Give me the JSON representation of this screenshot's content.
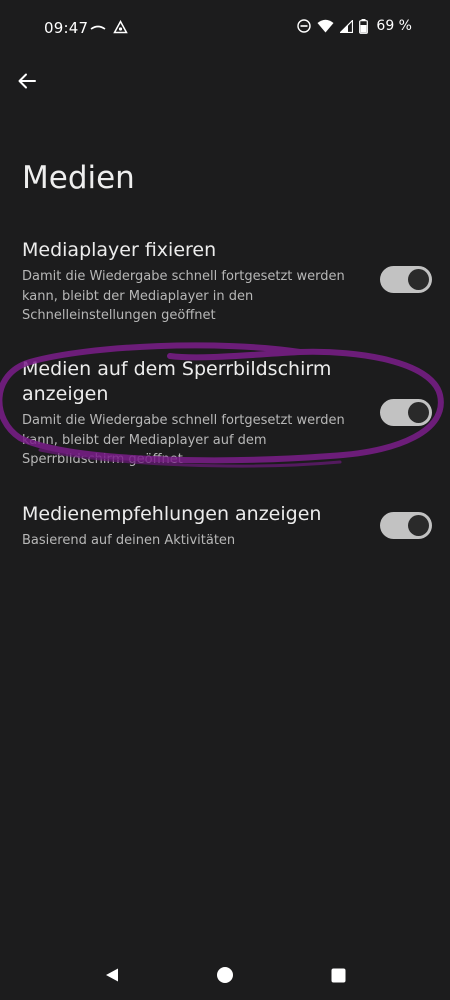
{
  "status_bar": {
    "time": "09:47",
    "battery_percent": "69 %",
    "icons_left": [
      "wave-icon",
      "navigation-app-icon"
    ],
    "icons_right": [
      "do-not-disturb-icon",
      "wifi-icon",
      "cell-signal-icon",
      "battery-icon"
    ]
  },
  "header": {
    "back_icon": "arrow-back-icon",
    "title": "Medien"
  },
  "settings": [
    {
      "title": "Mediaplayer fixieren",
      "description": "Damit die Wiedergabe schnell fortgesetzt werden kann, bleibt der Mediaplayer in den Schnelleinstellungen geöffnet",
      "enabled": true
    },
    {
      "title": "Medien auf dem Sperrbildschirm anzeigen",
      "description": "Damit die Wiedergabe schnell fortgesetzt werden kann, bleibt der Mediaplayer auf dem Sperrbildschirm geöffnet",
      "enabled": true
    },
    {
      "title": "Medienempfehlungen anzeigen",
      "description": "Basierend auf deinen Aktivitäten",
      "enabled": true
    }
  ],
  "colors": {
    "background": "#1c1c1d",
    "toggle_track": "#c2c2c2",
    "toggle_knob": "#2a2a2a",
    "annotation_stroke": "#7a1d8a"
  },
  "nav_bar": {
    "icons": [
      "back-triangle-icon",
      "home-circle-icon",
      "recents-square-icon"
    ]
  }
}
